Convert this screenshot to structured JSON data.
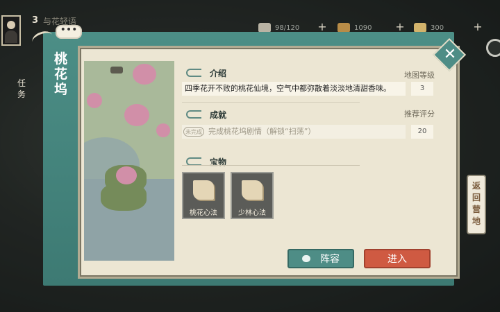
{
  "hud": {
    "level": "3",
    "task_name": "与花轻语",
    "resources": [
      {
        "name": "silver-icon",
        "value": "98/120",
        "plus": "+"
      },
      {
        "name": "goods-icon",
        "value": "1090",
        "plus": "+"
      },
      {
        "name": "gold-icon",
        "value": "300",
        "plus": "+"
      }
    ],
    "task_side": [
      "任",
      "务"
    ],
    "return_label": "返回营地"
  },
  "bubble": "•••",
  "panel": {
    "location_name": "桃花坞",
    "sections": {
      "intro": "介绍",
      "achievement": "成就",
      "treasure": "宝物"
    },
    "intro_text": "四季花开不败的桃花仙境，空气中都弥散着淡淡地清甜香味。",
    "map_level_label": "地图等级",
    "map_level_value": "3",
    "recommend_score_label": "推荐评分",
    "recommend_score_value": "20",
    "achievement_badge": "未完成",
    "achievement_text": "完成桃花坞剧情（解锁“扫荡”）",
    "treasures": [
      {
        "name": "桃花心法",
        "icon": "book-icon"
      },
      {
        "name": "少林心法",
        "icon": "book-icon"
      }
    ],
    "team_button": "阵容",
    "enter_button": "进入",
    "close_symbol": "✕"
  },
  "colors": {
    "teal": "#4e8d86",
    "enter_red": "#cf5a42",
    "parchment": "#ece6d3"
  }
}
